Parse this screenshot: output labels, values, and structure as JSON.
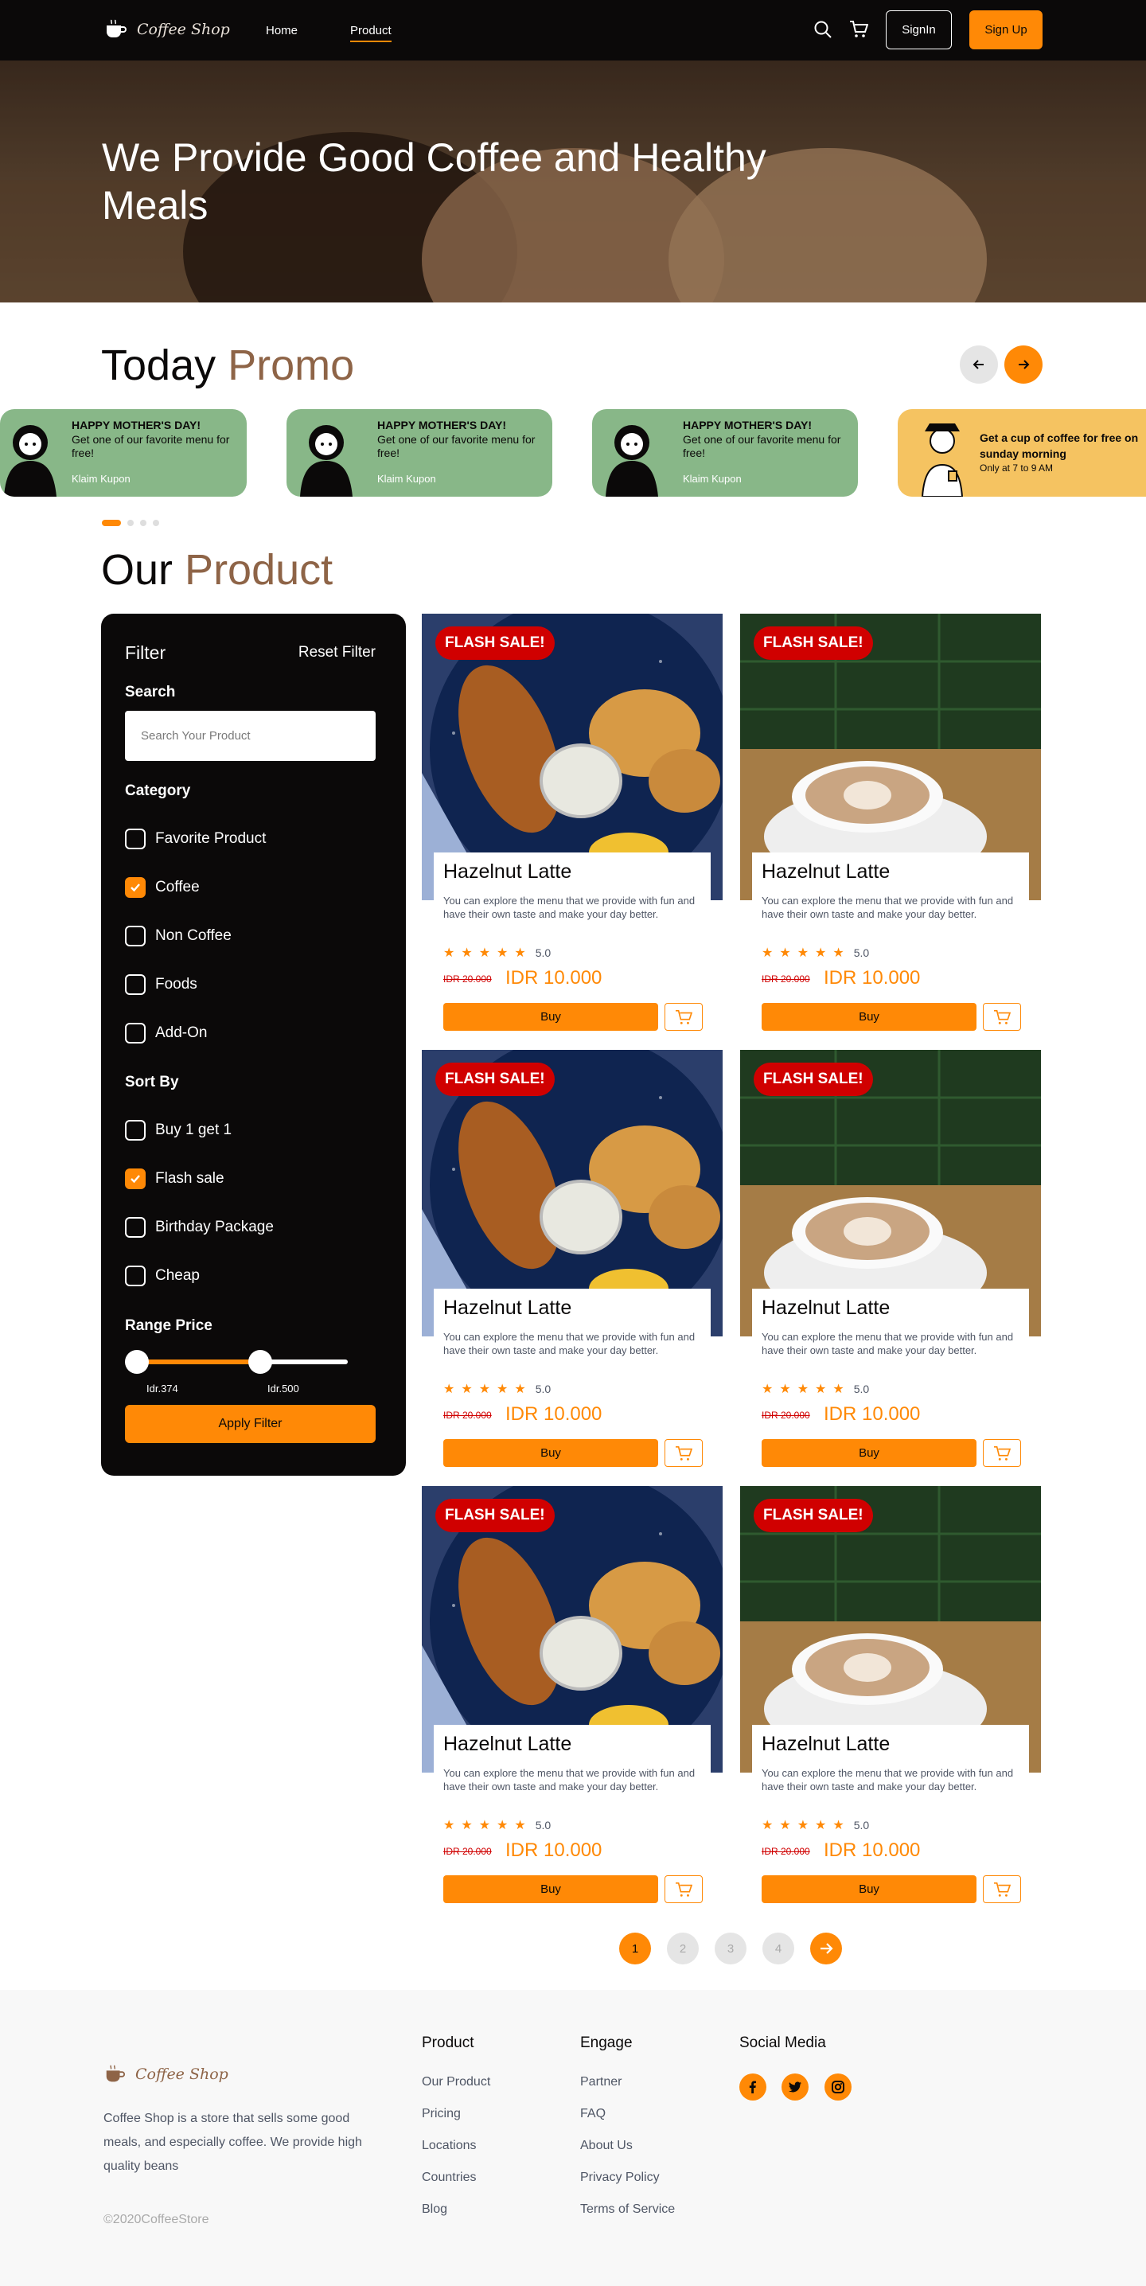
{
  "nav": {
    "logo": "Coffee Shop",
    "links": [
      "Home",
      "Product"
    ],
    "signin": "SignIn",
    "signup": "Sign Up"
  },
  "hero": {
    "title": "We Provide Good Coffee and Healthy Meals"
  },
  "promo": {
    "title_main": "Today",
    "title_accent": "Promo",
    "cards": [
      {
        "title": "HAPPY MOTHER'S DAY!",
        "desc": "Get one of our favorite menu for free!",
        "link": "Klaim Kupon"
      },
      {
        "title": "HAPPY MOTHER'S DAY!",
        "desc": "Get one of our favorite menu for free!",
        "link": "Klaim Kupon"
      },
      {
        "title": "HAPPY MOTHER'S DAY!",
        "desc": "Get one of our favorite menu for free!",
        "link": "Klaim Kupon"
      },
      {
        "title": "Get a cup of coffee for free on sunday morning",
        "desc": "Only at 7 to 9 AM"
      }
    ]
  },
  "product": {
    "title_main": "Our",
    "title_accent": "Product"
  },
  "filter": {
    "title": "Filter",
    "reset": "Reset Filter",
    "search_label": "Search",
    "search_placeholder": "Search Your Product",
    "category_label": "Category",
    "categories": [
      {
        "label": "Favorite Product",
        "checked": false
      },
      {
        "label": "Coffee",
        "checked": true
      },
      {
        "label": "Non Coffee",
        "checked": false
      },
      {
        "label": "Foods",
        "checked": false
      },
      {
        "label": "Add-On",
        "checked": false
      }
    ],
    "sort_label": "Sort By",
    "sorts": [
      {
        "label": "Buy 1 get 1",
        "checked": false
      },
      {
        "label": "Flash sale",
        "checked": true
      },
      {
        "label": "Birthday Package",
        "checked": false
      },
      {
        "label": "Cheap",
        "checked": false
      }
    ],
    "range_label": "Range Price",
    "range_min": "Idr.374",
    "range_max": "Idr.500",
    "apply": "Apply Filter"
  },
  "products": [
    {
      "badge": "FLASH SALE!",
      "name": "Hazelnut Latte",
      "desc": "You can explore the menu that we provide with fun and have their own taste and make your day better.",
      "rating": "5.0",
      "old_price": "IDR 20.000",
      "price": "IDR 10.000",
      "buy": "Buy",
      "image": "fried-food"
    },
    {
      "badge": "FLASH SALE!",
      "name": "Hazelnut Latte",
      "desc": "You can explore the menu that we provide with fun and have their own taste and make your day better.",
      "rating": "5.0",
      "old_price": "IDR 20.000",
      "price": "IDR 10.000",
      "buy": "Buy",
      "image": "latte"
    },
    {
      "badge": "FLASH SALE!",
      "name": "Hazelnut Latte",
      "desc": "You can explore the menu that we provide with fun and have their own taste and make your day better.",
      "rating": "5.0",
      "old_price": "IDR 20.000",
      "price": "IDR 10.000",
      "buy": "Buy",
      "image": "fried-food"
    },
    {
      "badge": "FLASH SALE!",
      "name": "Hazelnut Latte",
      "desc": "You can explore the menu that we provide with fun and have their own taste and make your day better.",
      "rating": "5.0",
      "old_price": "IDR 20.000",
      "price": "IDR 10.000",
      "buy": "Buy",
      "image": "latte"
    },
    {
      "badge": "FLASH SALE!",
      "name": "Hazelnut Latte",
      "desc": "You can explore the menu that we provide with fun and have their own taste and make your day better.",
      "rating": "5.0",
      "old_price": "IDR 20.000",
      "price": "IDR 10.000",
      "buy": "Buy",
      "image": "fried-food"
    },
    {
      "badge": "FLASH SALE!",
      "name": "Hazelnut Latte",
      "desc": "You can explore the menu that we provide with fun and have their own taste and make your day better.",
      "rating": "5.0",
      "old_price": "IDR 20.000",
      "price": "IDR 10.000",
      "buy": "Buy",
      "image": "latte"
    }
  ],
  "pagination": {
    "pages": [
      "1",
      "2",
      "3",
      "4"
    ],
    "current": "1"
  },
  "footer": {
    "logo": "Coffee Shop",
    "about": "Coffee Shop is a store that sells some good meals, and especially coffee. We provide high quality beans",
    "copyright": "©2020CoffeeStore",
    "product_head": "Product",
    "product_links": [
      "Our Product",
      "Pricing",
      "Locations",
      "Countries",
      "Blog"
    ],
    "engage_head": "Engage",
    "engage_links": [
      "Partner",
      "FAQ",
      "About Us",
      "Privacy Policy",
      "Terms of Service"
    ],
    "social_head": "Social Media",
    "social_icons": [
      "facebook-icon",
      "twitter-icon",
      "instagram-icon"
    ]
  },
  "colors": {
    "accent": "#ff8906",
    "dark": "#0b0909",
    "brown": "#8e6447",
    "flash": "#d00000",
    "promo_green": "#88b788",
    "promo_yellow": "#f5c361"
  }
}
